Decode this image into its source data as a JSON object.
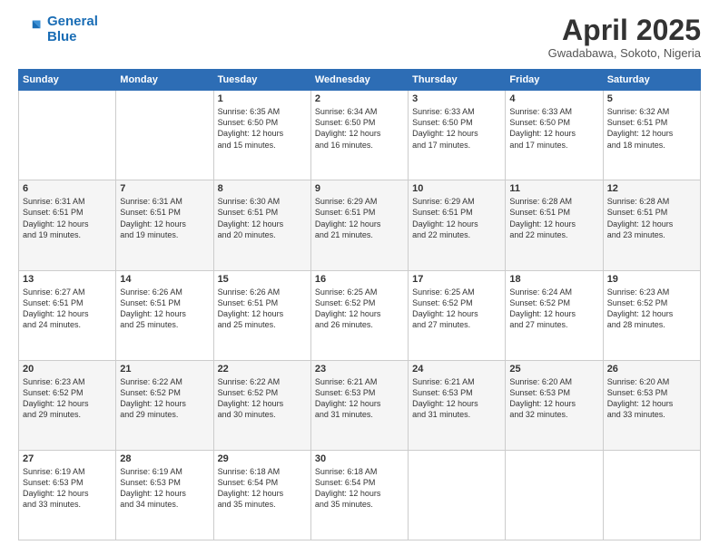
{
  "logo": {
    "line1": "General",
    "line2": "Blue"
  },
  "header": {
    "month": "April 2025",
    "location": "Gwadabawa, Sokoto, Nigeria"
  },
  "weekdays": [
    "Sunday",
    "Monday",
    "Tuesday",
    "Wednesday",
    "Thursday",
    "Friday",
    "Saturday"
  ],
  "weeks": [
    [
      {
        "day": "",
        "info": ""
      },
      {
        "day": "",
        "info": ""
      },
      {
        "day": "1",
        "info": "Sunrise: 6:35 AM\nSunset: 6:50 PM\nDaylight: 12 hours\nand 15 minutes."
      },
      {
        "day": "2",
        "info": "Sunrise: 6:34 AM\nSunset: 6:50 PM\nDaylight: 12 hours\nand 16 minutes."
      },
      {
        "day": "3",
        "info": "Sunrise: 6:33 AM\nSunset: 6:50 PM\nDaylight: 12 hours\nand 17 minutes."
      },
      {
        "day": "4",
        "info": "Sunrise: 6:33 AM\nSunset: 6:50 PM\nDaylight: 12 hours\nand 17 minutes."
      },
      {
        "day": "5",
        "info": "Sunrise: 6:32 AM\nSunset: 6:51 PM\nDaylight: 12 hours\nand 18 minutes."
      }
    ],
    [
      {
        "day": "6",
        "info": "Sunrise: 6:31 AM\nSunset: 6:51 PM\nDaylight: 12 hours\nand 19 minutes."
      },
      {
        "day": "7",
        "info": "Sunrise: 6:31 AM\nSunset: 6:51 PM\nDaylight: 12 hours\nand 19 minutes."
      },
      {
        "day": "8",
        "info": "Sunrise: 6:30 AM\nSunset: 6:51 PM\nDaylight: 12 hours\nand 20 minutes."
      },
      {
        "day": "9",
        "info": "Sunrise: 6:29 AM\nSunset: 6:51 PM\nDaylight: 12 hours\nand 21 minutes."
      },
      {
        "day": "10",
        "info": "Sunrise: 6:29 AM\nSunset: 6:51 PM\nDaylight: 12 hours\nand 22 minutes."
      },
      {
        "day": "11",
        "info": "Sunrise: 6:28 AM\nSunset: 6:51 PM\nDaylight: 12 hours\nand 22 minutes."
      },
      {
        "day": "12",
        "info": "Sunrise: 6:28 AM\nSunset: 6:51 PM\nDaylight: 12 hours\nand 23 minutes."
      }
    ],
    [
      {
        "day": "13",
        "info": "Sunrise: 6:27 AM\nSunset: 6:51 PM\nDaylight: 12 hours\nand 24 minutes."
      },
      {
        "day": "14",
        "info": "Sunrise: 6:26 AM\nSunset: 6:51 PM\nDaylight: 12 hours\nand 25 minutes."
      },
      {
        "day": "15",
        "info": "Sunrise: 6:26 AM\nSunset: 6:51 PM\nDaylight: 12 hours\nand 25 minutes."
      },
      {
        "day": "16",
        "info": "Sunrise: 6:25 AM\nSunset: 6:52 PM\nDaylight: 12 hours\nand 26 minutes."
      },
      {
        "day": "17",
        "info": "Sunrise: 6:25 AM\nSunset: 6:52 PM\nDaylight: 12 hours\nand 27 minutes."
      },
      {
        "day": "18",
        "info": "Sunrise: 6:24 AM\nSunset: 6:52 PM\nDaylight: 12 hours\nand 27 minutes."
      },
      {
        "day": "19",
        "info": "Sunrise: 6:23 AM\nSunset: 6:52 PM\nDaylight: 12 hours\nand 28 minutes."
      }
    ],
    [
      {
        "day": "20",
        "info": "Sunrise: 6:23 AM\nSunset: 6:52 PM\nDaylight: 12 hours\nand 29 minutes."
      },
      {
        "day": "21",
        "info": "Sunrise: 6:22 AM\nSunset: 6:52 PM\nDaylight: 12 hours\nand 29 minutes."
      },
      {
        "day": "22",
        "info": "Sunrise: 6:22 AM\nSunset: 6:52 PM\nDaylight: 12 hours\nand 30 minutes."
      },
      {
        "day": "23",
        "info": "Sunrise: 6:21 AM\nSunset: 6:53 PM\nDaylight: 12 hours\nand 31 minutes."
      },
      {
        "day": "24",
        "info": "Sunrise: 6:21 AM\nSunset: 6:53 PM\nDaylight: 12 hours\nand 31 minutes."
      },
      {
        "day": "25",
        "info": "Sunrise: 6:20 AM\nSunset: 6:53 PM\nDaylight: 12 hours\nand 32 minutes."
      },
      {
        "day": "26",
        "info": "Sunrise: 6:20 AM\nSunset: 6:53 PM\nDaylight: 12 hours\nand 33 minutes."
      }
    ],
    [
      {
        "day": "27",
        "info": "Sunrise: 6:19 AM\nSunset: 6:53 PM\nDaylight: 12 hours\nand 33 minutes."
      },
      {
        "day": "28",
        "info": "Sunrise: 6:19 AM\nSunset: 6:53 PM\nDaylight: 12 hours\nand 34 minutes."
      },
      {
        "day": "29",
        "info": "Sunrise: 6:18 AM\nSunset: 6:54 PM\nDaylight: 12 hours\nand 35 minutes."
      },
      {
        "day": "30",
        "info": "Sunrise: 6:18 AM\nSunset: 6:54 PM\nDaylight: 12 hours\nand 35 minutes."
      },
      {
        "day": "",
        "info": ""
      },
      {
        "day": "",
        "info": ""
      },
      {
        "day": "",
        "info": ""
      }
    ]
  ]
}
